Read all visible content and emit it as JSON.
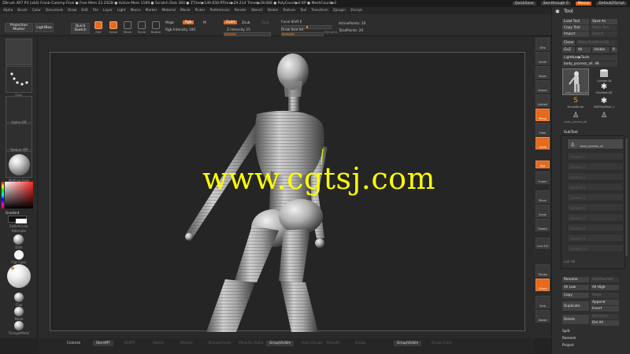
{
  "title_bar": {
    "text": "ZBrush 4R7 P3 (x64)    Frank-Cammy-Final    ● Free Mem 22.25GB ● Active Mem 1169 ● Scratch Disk 360 ● ZTime▶149.658 RTime▶29.214 Timer▶28.068 ● PolyCount▶0 KP ● MeshCount▶0",
    "quicksave": "QuickSave",
    "see_through": "See-through",
    "see_through_value": "0",
    "menus_label": "Menus",
    "script": "DefaultZScript"
  },
  "menu_bar": [
    "Alpha",
    "Brush",
    "Color",
    "Document",
    "Draw",
    "Edit",
    "File",
    "Layer",
    "Light",
    "Macro",
    "Marker",
    "Material",
    "Movie",
    "Picker",
    "Preferences",
    "Render",
    "Stencil",
    "Stroke",
    "Texture",
    "Tool",
    "Transform",
    "Zplugin",
    "Zscript"
  ],
  "top_shelf": {
    "projection_master": "Projection Master",
    "lightbox": "LightBox",
    "quick_sketch": "Quick Sketch",
    "tools": [
      {
        "label": "Edit",
        "icon": "edit-icon",
        "active": true
      },
      {
        "label": "Draw",
        "icon": "draw-icon",
        "active": true
      },
      {
        "label": "Move",
        "icon": "move-icon",
        "active": false
      },
      {
        "label": "Scale",
        "icon": "scale-icon",
        "active": false
      },
      {
        "label": "Rotate",
        "icon": "rotate-icon",
        "active": false
      }
    ],
    "mrgb": "Mrgb",
    "rgb": "Rgb",
    "m": "M",
    "rgb_intensity_label": "Rgb Intensity",
    "rgb_intensity_value": "100",
    "zadd": "Zadd",
    "zsub": "Zsub",
    "zcut": "Zcut",
    "z_intensity_label": "Z Intensity",
    "z_intensity_value": "25",
    "focal_shift_label": "Focal Shift",
    "focal_shift_value": "0",
    "draw_size_label": "Draw Size",
    "draw_size_value": "64",
    "dynamic_label": "Dynamic",
    "active_points_label": "ActivePoints:",
    "active_points_value": "20",
    "total_points_label": "TotalPoints:",
    "total_points_value": "20"
  },
  "left_shelf": {
    "brush_label": "Standard",
    "stroke_label": "Dots",
    "alpha_label": "Alpha Off",
    "texture_label": "Texture Off",
    "material_label": "MatCap Gray",
    "gradient_label": "Gradient",
    "switch_color_label": "SwitchColor",
    "alternate_label": "Alternate",
    "materials": [
      "Dots",
      "Flat Color",
      "",
      "Clay",
      "Metal",
      "TriangleMetal"
    ]
  },
  "right_shelf": [
    "SPix",
    "Scroll",
    "Zoom",
    "Actual",
    "AAHalf",
    "Persp",
    "Floor",
    "Local",
    "Xyz",
    "Frame",
    "Move",
    "Scale",
    "Rotate",
    "Line Fill",
    "Transp",
    "Ghost",
    "Solo",
    "Xpose"
  ],
  "tool_palette": {
    "title": "Tool",
    "load_tool": "Load Tool",
    "save_as": "Save As",
    "copy_tool": "Copy Tool",
    "paste_tool": "Paste Tool",
    "import": "Import",
    "export": "Export",
    "clone": "Clone",
    "make_polymesh": "Make PolyMesh3D",
    "goz": "GoZ",
    "all": "All",
    "visible": "Visible",
    "r": "R",
    "lightbox_tools": "Lightbox▶Tools",
    "current_tool": "body_process_all.",
    "current_tool_value": "48",
    "tools": [
      {
        "label": "body_process_all",
        "icon": "mannequin-icon"
      },
      {
        "label": "Cylinder3D",
        "icon": "cylinder-icon"
      },
      {
        "label": "",
        "icon": "star-icon"
      },
      {
        "label": "PolyMesh3D",
        "icon": "polymesh-star-icon"
      },
      {
        "label": "SimpleBrush",
        "icon": "simplebrush-icon"
      },
      {
        "label": "ZSBPolyMesh_1",
        "icon": "polymesh-star-icon"
      },
      {
        "label": "body_process_all",
        "icon": "mannequin-icon"
      },
      {
        "label": "",
        "icon": "mannequin-icon"
      }
    ],
    "subtool": "SubTool",
    "subtool_active": "body_process_all",
    "subtool_empty_rows": [
      "Subtool 1",
      "Subtool 2",
      "Subtool 3",
      "Subtool 4",
      "Subtool 5",
      "Subtool 6",
      "Subtool 7",
      "Subtool 8",
      "Subtool 9",
      "Subtool 10"
    ],
    "list_all": "List All",
    "rename": "Rename",
    "auto_reorder": "AutoReorder",
    "all_low": "All Low",
    "all_high": "All High",
    "copy": "Copy",
    "paste": "Paste",
    "duplicate": "Duplicate",
    "append": "Append",
    "insert": "Insert",
    "delete": "Delete",
    "del_other": "Del Other",
    "del_all": "Del All",
    "split": "Split",
    "remesh": "Remesh",
    "project": "Project"
  },
  "bottom_bar": {
    "colorize": "Colorize",
    "storemt": "StoreMT",
    "items": [
      "DelMT",
      "Switch",
      "Morphs",
      "Sharpenmesh",
      "Mask By Alpha",
      "Auto Groups",
      "RelaxPt",
      "Group",
      "Groups Visible",
      "GroupVisible"
    ],
    "groupvisible_left": "GroupVisible",
    "groupvisible_right": "GroupVisible",
    "group_clear": "Group Clear"
  },
  "watermark": "www.cgtsj.com",
  "colors": {
    "accent": "#e36a1e",
    "watermark": "#ffff00",
    "background": "#232323"
  }
}
